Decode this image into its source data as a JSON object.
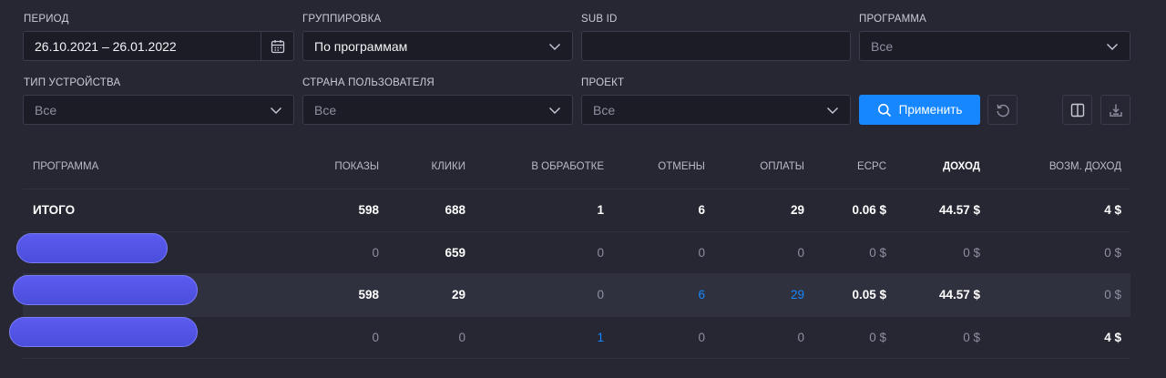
{
  "filters": {
    "period": {
      "label": "ПЕРИОД",
      "value": "26.10.2021 – 26.01.2022"
    },
    "grouping": {
      "label": "ГРУППИРОВКА",
      "value": "По программам"
    },
    "subid": {
      "label": "SUB ID",
      "value": ""
    },
    "program": {
      "label": "ПРОГРАММА",
      "value": "Все"
    },
    "device": {
      "label": "ТИП УСТРОЙСТВА",
      "value": "Все"
    },
    "country": {
      "label": "СТРАНА ПОЛЬЗОВАТЕЛЯ",
      "value": "Все"
    },
    "project": {
      "label": "ПРОЕКТ",
      "value": "Все"
    }
  },
  "actions": {
    "apply_label": "Применить",
    "icons": [
      "search-icon",
      "reset-icon",
      "columns-icon",
      "download-icon"
    ]
  },
  "colors": {
    "accent": "#1687ff",
    "background": "#262733",
    "redaction": "#5b5cf0"
  },
  "table": {
    "headers": [
      "ПРОГРАММА",
      "ПОКАЗЫ",
      "КЛИКИ",
      "В ОБРАБОТКЕ",
      "ОТМЕНЫ",
      "ОПЛАТЫ",
      "ECPC",
      "ДОХОД",
      "ВОЗМ. ДОХОД"
    ],
    "rows": [
      {
        "name": "ИТОГО",
        "shows": "598",
        "clicks": "688",
        "processing": "1",
        "cancels": "6",
        "payments": "29",
        "ecpc": "0.06 $",
        "income": "44.57 $",
        "possible": "4 $"
      },
      {
        "name": "",
        "shows": "0",
        "clicks": "659",
        "processing": "0",
        "cancels": "0",
        "payments": "0",
        "ecpc": "0 $",
        "income": "0 $",
        "possible": "0 $"
      },
      {
        "name": "",
        "shows": "598",
        "clicks": "29",
        "processing": "0",
        "cancels": "6",
        "payments": "29",
        "ecpc": "0.05 $",
        "income": "44.57 $",
        "possible": "0 $"
      },
      {
        "name": "",
        "shows": "0",
        "clicks": "0",
        "processing": "1",
        "cancels": "0",
        "payments": "0",
        "ecpc": "0 $",
        "income": "0 $",
        "possible": "4 $"
      }
    ]
  }
}
